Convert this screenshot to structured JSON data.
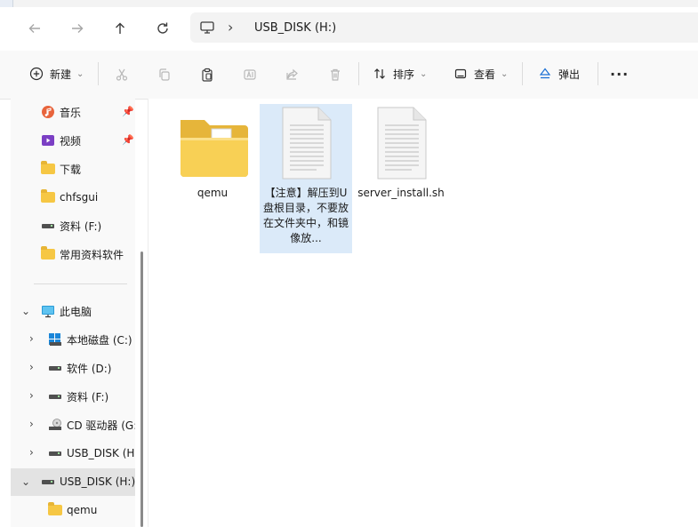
{
  "nav": {
    "back_icon": "arrow-left-icon",
    "forward_icon": "arrow-right-icon",
    "up_icon": "arrow-up-icon",
    "refresh_icon": "refresh-icon",
    "path_icon": "computer-icon",
    "path": "USB_DISK (H:)"
  },
  "toolbar": {
    "new_label": "新建",
    "sort_label": "排序",
    "view_label": "查看",
    "eject_label": "弹出",
    "more": "···"
  },
  "sidebar": {
    "quick": [
      {
        "label": "音乐",
        "icon": "music-icon",
        "pinned": true
      },
      {
        "label": "视频",
        "icon": "video-icon",
        "pinned": true
      },
      {
        "label": "下载",
        "icon": "folder-icon"
      },
      {
        "label": "chfsgui",
        "icon": "folder-icon"
      },
      {
        "label": "资料 (F:)",
        "icon": "drive-icon"
      },
      {
        "label": "常用资料软件",
        "icon": "folder-icon"
      }
    ],
    "this_pc": {
      "label": "此电脑",
      "icon": "monitor-icon"
    },
    "drives": [
      {
        "label": "本地磁盘 (C:)",
        "icon": "windows-drive-icon"
      },
      {
        "label": "软件 (D:)",
        "icon": "drive-icon"
      },
      {
        "label": "资料 (F:)",
        "icon": "drive-icon"
      },
      {
        "label": "CD 驱动器 (G:",
        "icon": "cd-drive-icon"
      },
      {
        "label": "USB_DISK (H:",
        "icon": "drive-icon"
      }
    ],
    "selected": {
      "label": "USB_DISK (H:)",
      "icon": "drive-icon"
    },
    "child": {
      "label": "qemu",
      "icon": "folder-icon"
    }
  },
  "files": [
    {
      "name": "qemu",
      "type": "folder"
    },
    {
      "name": "【注意】解压到U盘根目录，不要放在文件夹中，和镜像放...",
      "type": "text-file",
      "selected": true
    },
    {
      "name": "server_install.sh",
      "type": "text-file"
    }
  ]
}
